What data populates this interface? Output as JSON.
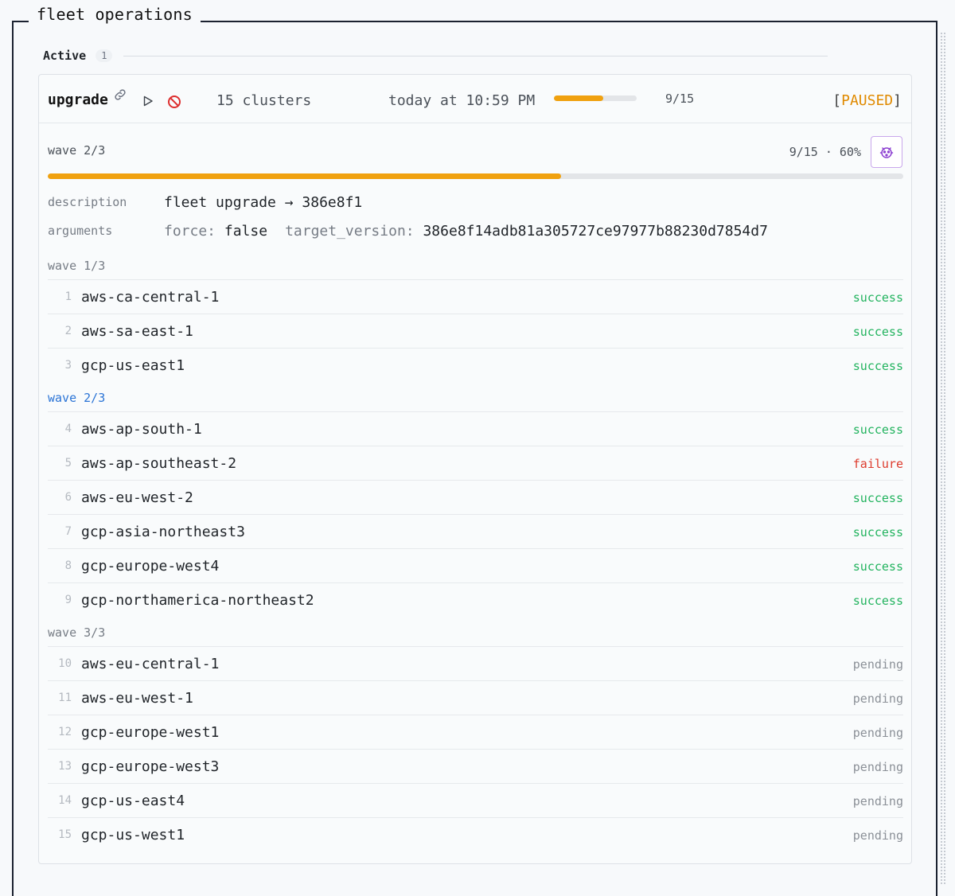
{
  "panel": {
    "title": "fleet operations"
  },
  "tabs": [
    {
      "label": "Active",
      "count": "1"
    }
  ],
  "operation": {
    "name": "upgrade",
    "clusters": "15 clusters",
    "time": "today at 10:59 PM",
    "progress_fraction": 0.6,
    "progress_text": "9/15",
    "status_open": "[",
    "status": "PAUSED",
    "status_close": "]",
    "icons": {
      "link": "link-icon",
      "resume": "play-icon",
      "cancel": "cancel-icon",
      "debug": "bug-icon"
    },
    "colors": {
      "progress": "#f0a10f",
      "paused": "#e08a00",
      "success": "#22b35e",
      "failure": "#dd3b2d",
      "pending": "#8b9097",
      "current_wave": "#2b74d6"
    }
  },
  "current_wave": {
    "label": "wave 2/3",
    "count_text": "9/15 · 60%"
  },
  "details": {
    "description_label": "description",
    "description": "fleet upgrade → 386e8f1",
    "arguments_label": "arguments",
    "arguments": [
      {
        "key": "force:",
        "value": "false"
      },
      {
        "key": "target_version:",
        "value": "386e8f14adb81a305727ce97977b88230d7854d7"
      }
    ]
  },
  "waves": [
    {
      "label": "wave 1/3",
      "current": false,
      "rows": [
        {
          "num": "1",
          "name": "aws-ca-central-1",
          "status": "success"
        },
        {
          "num": "2",
          "name": "aws-sa-east-1",
          "status": "success"
        },
        {
          "num": "3",
          "name": "gcp-us-east1",
          "status": "success"
        }
      ]
    },
    {
      "label": "wave 2/3",
      "current": true,
      "rows": [
        {
          "num": "4",
          "name": "aws-ap-south-1",
          "status": "success"
        },
        {
          "num": "5",
          "name": "aws-ap-southeast-2",
          "status": "failure"
        },
        {
          "num": "6",
          "name": "aws-eu-west-2",
          "status": "success"
        },
        {
          "num": "7",
          "name": "gcp-asia-northeast3",
          "status": "success"
        },
        {
          "num": "8",
          "name": "gcp-europe-west4",
          "status": "success"
        },
        {
          "num": "9",
          "name": "gcp-northamerica-northeast2",
          "status": "success"
        }
      ]
    },
    {
      "label": "wave 3/3",
      "current": false,
      "rows": [
        {
          "num": "10",
          "name": "aws-eu-central-1",
          "status": "pending"
        },
        {
          "num": "11",
          "name": "aws-eu-west-1",
          "status": "pending"
        },
        {
          "num": "12",
          "name": "gcp-europe-west1",
          "status": "pending"
        },
        {
          "num": "13",
          "name": "gcp-europe-west3",
          "status": "pending"
        },
        {
          "num": "14",
          "name": "gcp-us-east4",
          "status": "pending"
        },
        {
          "num": "15",
          "name": "gcp-us-west1",
          "status": "pending"
        }
      ]
    }
  ]
}
